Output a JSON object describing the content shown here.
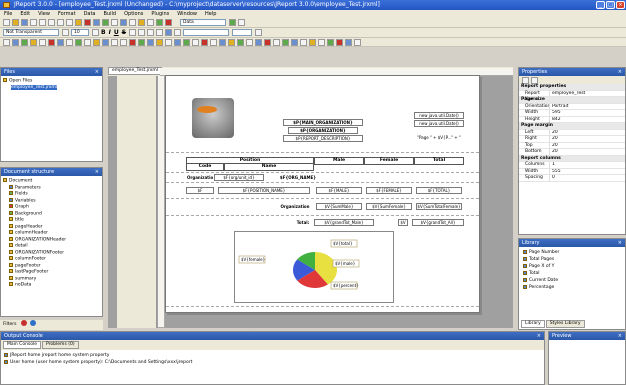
{
  "window": {
    "title": "JReport 3.0.0 - [employee_Test.jrxml (Unchanged) - C:\\myproject\\dataserver\\resources\\JReport 3.0.0\\employee_Test.jrxml]"
  },
  "menu": [
    "File",
    "Edit",
    "View",
    "Format",
    "Data",
    "Build",
    "Options",
    "Plugins",
    "Window",
    "Help"
  ],
  "toolbar": {
    "font": "Not Transparent",
    "size": "10",
    "datasource": "Data"
  },
  "format_buttons": [
    "B",
    "I",
    "U",
    "S"
  ],
  "files_panel": {
    "title": "Files",
    "items": [
      "Open Files",
      "employee_Test.jrxml"
    ]
  },
  "doc_panel": {
    "title": "Document structure",
    "items": [
      "Document",
      "Parameters",
      "Fields",
      "Variables",
      "Graph",
      "Background",
      "title",
      "pageHeader",
      "columnHeader",
      "ORGANIZATIONHeader",
      "detail",
      "ORGANIZATIONFooter",
      "columnFooter",
      "pageFooter",
      "lastPageFooter",
      "summary",
      "noData"
    ]
  },
  "filters": "Filters",
  "report": {
    "tab": "employee_Test.jrxml",
    "main_org": "$P{MAIN_ORGANIZATION}",
    "org": "$P{ORGANIZATION}",
    "desc": "$P{REPORT_DESCRIPTION}",
    "date1": "new java.util.Date()",
    "date2": "new java.util.Date()",
    "page": "\"Page \" + $V{P...\" + \"",
    "col_position": "Position",
    "col_male": "Male",
    "col_female": "Female",
    "col_total": "Total",
    "col_code": "Code",
    "col_name": "Name",
    "org_label": "Organization",
    "org_id": "$F{org/unit_id}",
    "org_name": "$F{ORG_NAME}",
    "male_sum": "$F{MALE}",
    "female_sum": "$F{FEMALE}",
    "total_sum": "$F{TOTAL}",
    "pos_id": "$F",
    "pos_name": "$F{POSITION_NAME}",
    "v1": "$F{...}",
    "v2": "$F{...}",
    "v3": "$F{...}",
    "org_footer": "Organization",
    "of1": "$V{SumMale}",
    "of2": "$V{SumFemale}",
    "of3": "$V{SumTotalFemale}",
    "total_label": "Total:",
    "gt1": "$V{grandTot_Male}",
    "gt2": "$V",
    "gt3": "$V{grandTot_All}",
    "legend_female": "$V{female}",
    "legend_total": "$V{total}",
    "legend_male": "$V{male}",
    "legend_percent": "$V{percent}"
  },
  "properties": {
    "title": "Properties",
    "rows": [
      {
        "cat": true,
        "k": "Report properties"
      },
      {
        "k": "Report Name",
        "v": "employee_Test"
      },
      {
        "cat": true,
        "k": "Page size"
      },
      {
        "k": "Orientation",
        "v": "Portrait"
      },
      {
        "k": "Width",
        "v": "595"
      },
      {
        "k": "Height",
        "v": "842"
      },
      {
        "cat": true,
        "k": "Page margin"
      },
      {
        "k": "Left",
        "v": "20"
      },
      {
        "k": "Right",
        "v": "20"
      },
      {
        "k": "Top",
        "v": "20"
      },
      {
        "k": "Bottom",
        "v": "20"
      },
      {
        "cat": true,
        "k": "Report columns"
      },
      {
        "k": "Columns",
        "v": "1"
      },
      {
        "k": "Width",
        "v": "555"
      },
      {
        "k": "Spacing",
        "v": "0"
      }
    ]
  },
  "library": {
    "title": "Library",
    "items": [
      "Page Number",
      "Total Pages",
      "Page X of Y",
      "Total",
      "Current Date",
      "Percentage"
    ],
    "tabs": [
      "Library",
      "Styles Library"
    ]
  },
  "output": {
    "title": "Output Console",
    "tabs": [
      "Main Console",
      "Problems (0)"
    ],
    "lines": [
      "JReport home jreport home system property",
      "User home (user home system property): C:\\Documents and Settings\\xxx\\jreport"
    ]
  },
  "preview_title": "Preview",
  "chart_data": {
    "type": "pie",
    "categories": [
      "$V{female}",
      "$V{total}",
      "$V{male}",
      "$V{percent}"
    ],
    "values": [
      40,
      25,
      20,
      15
    ],
    "colors": [
      "#e8e040",
      "#e03838",
      "#3a5ad8",
      "#40b040"
    ],
    "title": "",
    "xlabel": "",
    "ylabel": ""
  }
}
